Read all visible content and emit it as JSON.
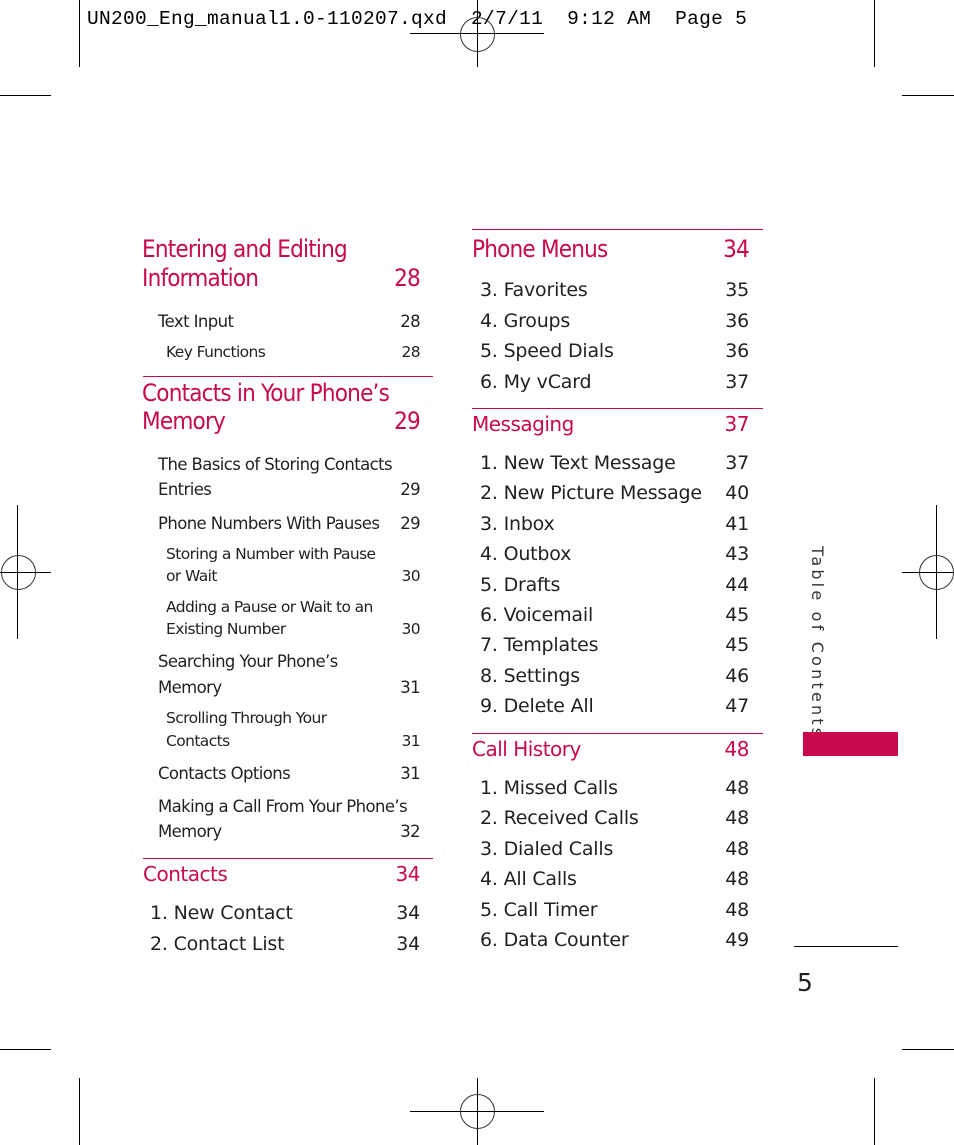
{
  "slug": "UN200_Eng_manual1.0-110207.qxd  2/7/11  9:12 AM  Page 5",
  "side_tab": {
    "label": "Table of Contents",
    "color": "#c8094d"
  },
  "page_number": "5",
  "accent_color": "#c8094d",
  "left_column": {
    "sections": [
      {
        "title_line1": "Entering and Editing",
        "title_line2": "Information",
        "page": "28",
        "entries": [
          {
            "level": 1,
            "line1": "Text Input",
            "line2": "",
            "page": "28"
          },
          {
            "level": 2,
            "line1": "Key Functions",
            "line2": "",
            "page": "28"
          }
        ]
      },
      {
        "title_line1": "Contacts in Your Phone’s",
        "title_line2": "Memory",
        "page": "29",
        "entries": [
          {
            "level": 1,
            "line1": "The Basics of Storing Contacts",
            "line2": "Entries",
            "page": "29"
          },
          {
            "level": 1,
            "line1": "Phone Numbers With Pauses",
            "line2": "",
            "page": "29"
          },
          {
            "level": 2,
            "line1": "Storing a Number with Pause",
            "line2": "or Wait",
            "page": "30"
          },
          {
            "level": 2,
            "line1": "Adding a Pause or Wait to an",
            "line2": "Existing Number",
            "page": "30"
          },
          {
            "level": 1,
            "line1": "Searching Your Phone’s",
            "line2": "Memory",
            "page": "31"
          },
          {
            "level": 2,
            "line1": "Scrolling Through Your",
            "line2": "Contacts",
            "page": "31"
          },
          {
            "level": 1,
            "line1": "Contacts Options",
            "line2": "",
            "page": "31"
          },
          {
            "level": 1,
            "line1": "Making a Call From Your Phone’s",
            "line2": "Memory",
            "page": "32"
          }
        ]
      },
      {
        "title": "Contacts",
        "page": "34",
        "entries": [
          {
            "label": "1. New Contact",
            "page": "34"
          },
          {
            "label": "2. Contact List",
            "page": "34"
          }
        ]
      }
    ]
  },
  "right_column": {
    "sections": [
      {
        "title": "Phone Menus",
        "page": "34",
        "entries": [
          {
            "label": "3. Favorites",
            "page": "35"
          },
          {
            "label": "4. Groups",
            "page": "36"
          },
          {
            "label": "5. Speed Dials",
            "page": "36"
          },
          {
            "label": "6. My vCard",
            "page": "37"
          }
        ]
      },
      {
        "title": "Messaging",
        "page": "37",
        "entries": [
          {
            "label": "1. New Text Message",
            "page": "37"
          },
          {
            "label": "2. New Picture Message",
            "page": "40"
          },
          {
            "label": "3. Inbox",
            "page": "41"
          },
          {
            "label": "4. Outbox",
            "page": "43"
          },
          {
            "label": "5. Drafts",
            "page": "44"
          },
          {
            "label": "6. Voicemail",
            "page": "45"
          },
          {
            "label": "7. Templates",
            "page": "45"
          },
          {
            "label": "8. Settings",
            "page": "46"
          },
          {
            "label": "9. Delete All",
            "page": "47"
          }
        ]
      },
      {
        "title": "Call History",
        "page": "48",
        "entries": [
          {
            "label": "1. Missed Calls",
            "page": "48"
          },
          {
            "label": "2. Received Calls",
            "page": "48"
          },
          {
            "label": "3. Dialed Calls",
            "page": "48"
          },
          {
            "label": "4. All Calls",
            "page": "48"
          },
          {
            "label": "5. Call Timer",
            "page": "48"
          },
          {
            "label": "6. Data Counter",
            "page": "49"
          }
        ]
      }
    ]
  }
}
